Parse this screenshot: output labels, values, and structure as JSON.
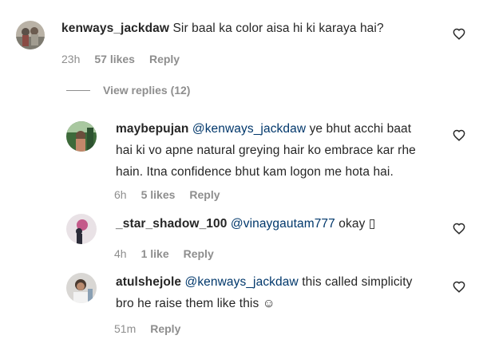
{
  "comments": [
    {
      "username": "kenways_jackdaw",
      "mention": "",
      "text": "Sir baal ka color aisa hi ki karaya hai?",
      "lines": [
        "Sir baal ka color aisa hi ki karaya hai?"
      ],
      "time": "23h",
      "likes": "57 likes",
      "reply": "Reply"
    },
    {
      "username": "maybepujan",
      "mention": "@kenways_jackdaw",
      "lines": [
        "ye bhut acchi baat",
        "hai ki vo apne natural greying hair ko embrace kar rhe",
        "hain. Itna confidence bhut kam logon me hota hai."
      ],
      "time": "6h",
      "likes": "5 likes",
      "reply": "Reply"
    },
    {
      "username": "_star_shadow_100",
      "mention": "@vinaygautam777",
      "lines": [
        "okay ▯"
      ],
      "time": "4h",
      "likes": "1 like",
      "reply": "Reply"
    },
    {
      "username": "atulshejole",
      "mention": "@kenways_jackdaw",
      "lines": [
        "this called simplicity",
        "bro he raise them like this ☺"
      ],
      "time": "51m",
      "likes": "",
      "reply": "Reply"
    }
  ],
  "view_replies": "View replies (12)",
  "icons": {
    "like": "heart-outline-icon"
  }
}
